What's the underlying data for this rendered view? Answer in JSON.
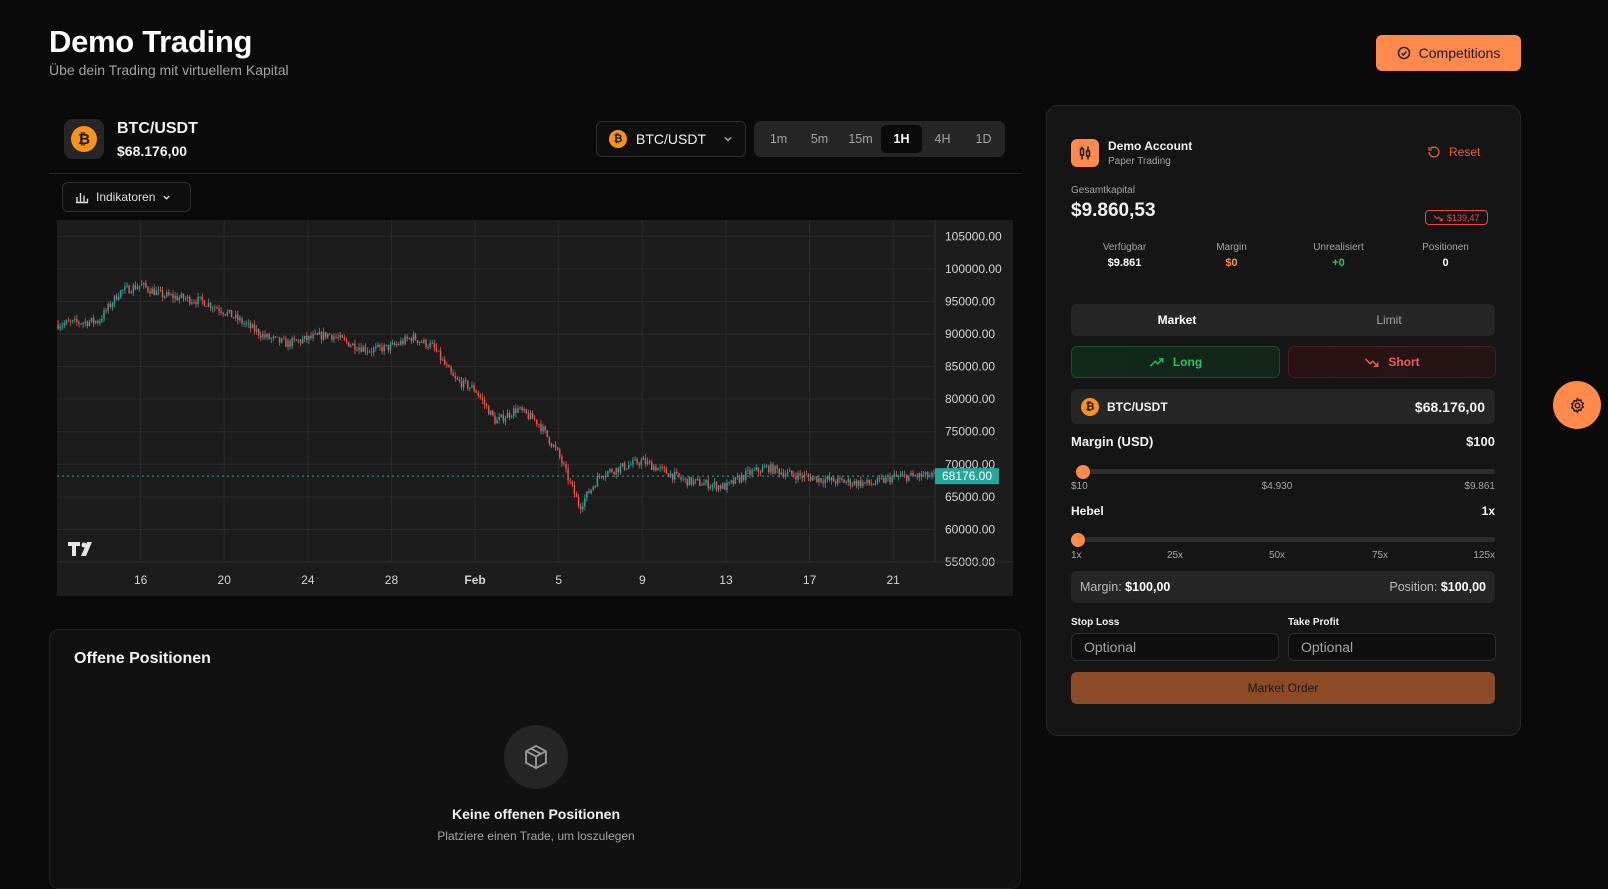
{
  "header": {
    "title": "Demo Trading",
    "subtitle": "Übe dein Trading mit virtuellem Kapital",
    "competitions_label": "Competitions"
  },
  "ticker": {
    "coin_symbol": "₿",
    "pair": "BTC/USDT",
    "price": "$68.176,00",
    "selector_label": "BTC/USDT",
    "timeframes": [
      "1m",
      "5m",
      "15m",
      "1H",
      "4H",
      "1D"
    ],
    "active_timeframe": "1H",
    "indicators_label": "Indikatoren"
  },
  "chart_data": {
    "type": "candlestick",
    "title": "",
    "ylim": [
      55000,
      107500
    ],
    "y_ticks": [
      "105000.00",
      "100000.00",
      "95000.00",
      "90000.00",
      "85000.00",
      "80000.00",
      "75000.00",
      "70000.00",
      "65000.00",
      "60000.00",
      "55000.00"
    ],
    "x_ticks": [
      "16",
      "20",
      "24",
      "28",
      "Feb",
      "5",
      "9",
      "13",
      "17",
      "21"
    ],
    "current_price_label": "68176.00",
    "current_price": 68176,
    "up_color": "#26a69a",
    "down_color": "#ef5350",
    "approx_price_path": [
      {
        "x": "12 Jan",
        "y": 91500
      },
      {
        "x": "14 Jan",
        "y": 92000
      },
      {
        "x": "15 Jan",
        "y": 96500
      },
      {
        "x": "16 Jan",
        "y": 97500
      },
      {
        "x": "17 Jan",
        "y": 96000
      },
      {
        "x": "19 Jan",
        "y": 95000
      },
      {
        "x": "20 Jan",
        "y": 93500
      },
      {
        "x": "21 Jan",
        "y": 91500
      },
      {
        "x": "22 Jan",
        "y": 89500
      },
      {
        "x": "23 Jan",
        "y": 88500
      },
      {
        "x": "25 Jan",
        "y": 90000
      },
      {
        "x": "26 Jan",
        "y": 88500
      },
      {
        "x": "27 Jan",
        "y": 87500
      },
      {
        "x": "28 Jan",
        "y": 88000
      },
      {
        "x": "29 Jan",
        "y": 89500
      },
      {
        "x": "30 Jan",
        "y": 88000
      },
      {
        "x": "31 Jan",
        "y": 83000
      },
      {
        "x": "1 Feb",
        "y": 81500
      },
      {
        "x": "2 Feb",
        "y": 76500
      },
      {
        "x": "3 Feb",
        "y": 78500
      },
      {
        "x": "4 Feb",
        "y": 76500
      },
      {
        "x": "5 Feb",
        "y": 71500
      },
      {
        "x": "6 Feb",
        "y": 63500
      },
      {
        "x": "7 Feb",
        "y": 68500
      },
      {
        "x": "9 Feb",
        "y": 70500
      },
      {
        "x": "10 Feb",
        "y": 69000
      },
      {
        "x": "11 Feb",
        "y": 67500
      },
      {
        "x": "13 Feb",
        "y": 66500
      },
      {
        "x": "14 Feb",
        "y": 68500
      },
      {
        "x": "15 Feb",
        "y": 69500
      },
      {
        "x": "16 Feb",
        "y": 68500
      },
      {
        "x": "18 Feb",
        "y": 67500
      },
      {
        "x": "20 Feb",
        "y": 67000
      },
      {
        "x": "21 Feb",
        "y": 68000
      },
      {
        "x": "22 Feb",
        "y": 68176
      }
    ]
  },
  "positions": {
    "title": "Offene Positionen",
    "empty_title": "Keine offenen Positionen",
    "empty_subtitle": "Platziere einen Trade, um loszulegen"
  },
  "account": {
    "name": "Demo Account",
    "type": "Paper Trading",
    "reset_label": "Reset",
    "capital_label": "Gesamtkapital",
    "capital_value": "$9.860,53",
    "pnl_badge": "$139,47",
    "stats": [
      {
        "label": "Verfügbar",
        "value": "$9.861",
        "color": "#ffffff"
      },
      {
        "label": "Margin",
        "value": "$0",
        "color": "#ff8a4c"
      },
      {
        "label": "Unrealisiert",
        "value": "+0",
        "color": "#22c55e"
      },
      {
        "label": "Positionen",
        "value": "0",
        "color": "#ffffff"
      }
    ]
  },
  "order": {
    "type_tabs": [
      "Market",
      "Limit"
    ],
    "active_type": "Market",
    "long_label": "Long",
    "short_label": "Short",
    "asset_pair": "BTC/USDT",
    "asset_price": "$68.176,00",
    "margin_label": "Margin (USD)",
    "margin_value": "$100",
    "margin_ticks": [
      "$10",
      "$4.930",
      "$9.861"
    ],
    "margin_fraction": 0.0,
    "leverage_label": "Hebel",
    "leverage_value": "1x",
    "leverage_ticks": [
      "1x",
      "25x",
      "50x",
      "75x",
      "125x"
    ],
    "leverage_fraction": 0.0,
    "summary_margin_label": "Margin:",
    "summary_margin_value": "$100,00",
    "summary_position_label": "Position:",
    "summary_position_value": "$100,00",
    "stop_loss_label": "Stop Loss",
    "take_profit_label": "Take Profit",
    "stop_loss_placeholder": "Optional",
    "take_profit_placeholder": "Optional",
    "submit_label": "Market Order"
  },
  "colors": {
    "accent": "#ff8a4c",
    "positive": "#22c55e",
    "negative": "#ef4444"
  }
}
